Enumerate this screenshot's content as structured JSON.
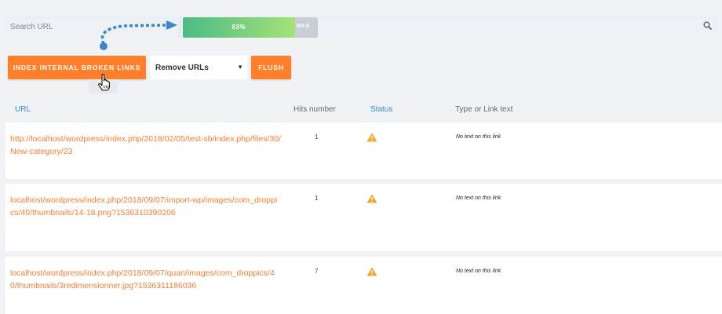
{
  "search": {
    "placeholder": "Search URL"
  },
  "progress": {
    "percent": 83,
    "label": "83%",
    "tail_text": "NKS"
  },
  "toolbar": {
    "index_button": "INDEX INTERNAL BROKEN LINKS",
    "action_select": "Remove URLs",
    "flush_button": "FLUSH"
  },
  "table": {
    "headers": {
      "url": "URL",
      "hits": "Hits number",
      "status": "Status",
      "type": "Type or Link text"
    },
    "rows": [
      {
        "url": "http://localhost/wordpress/index.php/2018/02/05/test-sb/index.php/files/30/New-category/23",
        "hits": "1",
        "status": "warning",
        "link_text": "No text on this link"
      },
      {
        "url": "localhost/wordpress/index.php/2018/09/07/import-wp/images/com_droppics/40/thumbnails/14-18.png?1536310390206",
        "hits": "1",
        "status": "warning",
        "link_text": "No text on this link"
      },
      {
        "url": "localhost/wordpress/index.php/2018/09/07/quan/images/com_droppics/40/thumbnails/3redimensionner.jpg?1536311186036",
        "hits": "7",
        "status": "warning",
        "link_text": "No text on this link"
      }
    ]
  },
  "colors": {
    "accent": "#ff7f2a",
    "link": "#f37f32",
    "header_blue": "#2e8fc6",
    "warning": "#f5a623",
    "progress_start": "#4cbb85",
    "progress_end": "#a4e278",
    "annotation_arrow": "#3d86c6"
  },
  "icons": {
    "search": "search-icon",
    "warning": "warning-icon",
    "cursor": "hand-cursor-icon",
    "annotation": "dotted-arrow-icon"
  }
}
